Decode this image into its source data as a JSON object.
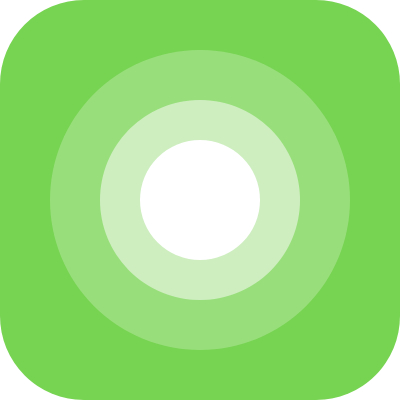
{
  "icon": {
    "name": "target-rings-icon",
    "colors": {
      "background": "#77d352",
      "outer_ring": "#98df7b",
      "middle_ring": "#ceeec0",
      "core": "#ffffff"
    }
  }
}
